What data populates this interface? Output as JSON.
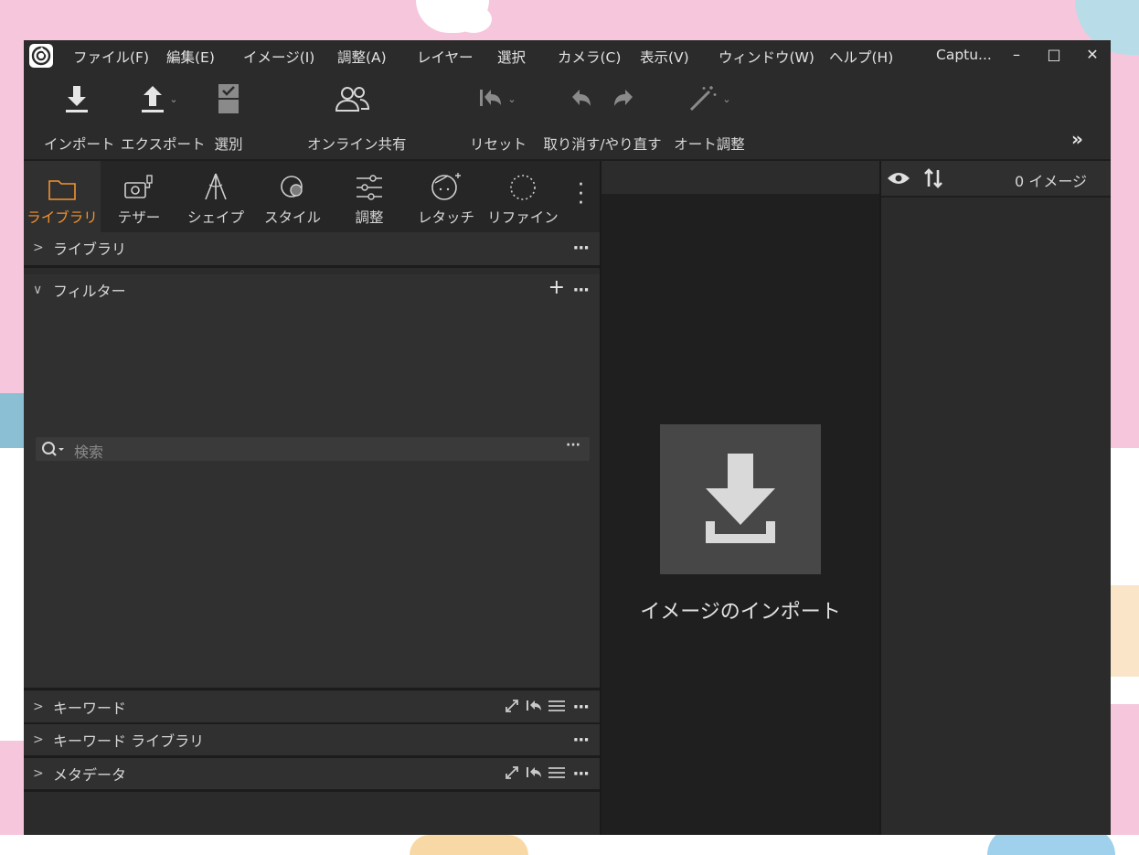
{
  "menubar": {
    "items": [
      "ファイル(F)",
      "編集(E)",
      "イメージ(I)",
      "調整(A)",
      "レイヤー",
      "選択",
      "カメラ(C)",
      "表示(V)",
      "ウィンドウ(W)",
      "ヘルプ(H)"
    ],
    "window_title": "Captu...",
    "minimize": "–",
    "maximize": "□",
    "close": "✕"
  },
  "toolbar": {
    "import": "インポート",
    "export": "エクスポート",
    "select": "選別",
    "share": "オンライン共有",
    "reset": "リセット",
    "undo_redo": "取り消す/やり直す",
    "auto_adjust": "オート調整",
    "more": "»"
  },
  "tabs": [
    "ライブラリ",
    "テザー",
    "シェイプ",
    "スタイル",
    "調整",
    "レタッチ",
    "リファイン"
  ],
  "sections": {
    "library": "ライブラリ",
    "filter": "フィルター",
    "keywords": "キーワード",
    "keyword_library": "キーワード ライブラリ",
    "metadata": "メタデータ"
  },
  "search": {
    "placeholder": "検索"
  },
  "center": {
    "import_label": "イメージのインポート"
  },
  "right": {
    "count": "0 イメージ"
  },
  "colors": {
    "accent": "#f2922e",
    "panel": "#2b2b2b",
    "viewer": "#1f1f1f"
  }
}
